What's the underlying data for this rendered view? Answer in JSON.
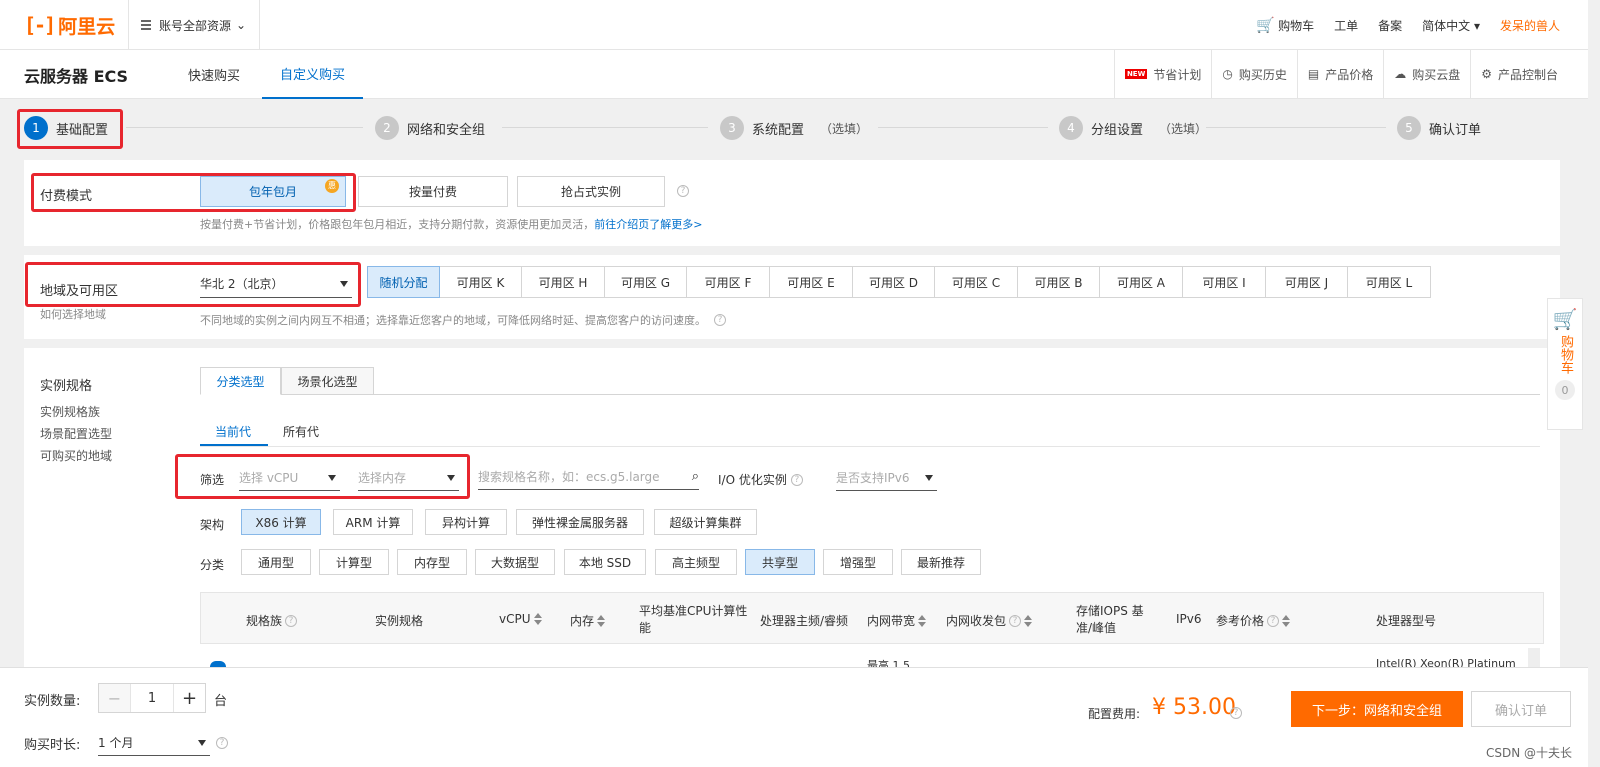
{
  "topbar": {
    "logo_text": "阿里云",
    "account_scope": "账号全部资源",
    "nav": [
      "购物车",
      "工单",
      "备案",
      "简体中文"
    ],
    "user": "发呆的兽人"
  },
  "product": {
    "name": "云服务器 ECS",
    "tabs": [
      "快速购买",
      "自定义购买"
    ],
    "tools": [
      "节省计划",
      "购买历史",
      "产品价格",
      "购买云盘",
      "产品控制台"
    ],
    "new_badge": "NEW"
  },
  "steps": [
    {
      "num": "1",
      "label": "基础配置",
      "opt": ""
    },
    {
      "num": "2",
      "label": "网络和安全组",
      "opt": ""
    },
    {
      "num": "3",
      "label": "系统配置",
      "opt": "（选填）"
    },
    {
      "num": "4",
      "label": "分组设置",
      "opt": "（选填）"
    },
    {
      "num": "5",
      "label": "确认订单",
      "opt": ""
    }
  ],
  "billing": {
    "label": "付费模式",
    "options": [
      "包年包月",
      "按量付费",
      "抢占式实例"
    ],
    "hint": "按量付费+节省计划，价格跟包年包月相近，支持分期付款，资源使用更加灵活，",
    "hint_link": "前往介绍页了解更多>"
  },
  "region": {
    "label": "地域及可用区",
    "sub_link": "如何选择地域",
    "selected": "华北 2（北京）",
    "zones": [
      "随机分配",
      "可用区 K",
      "可用区 H",
      "可用区 G",
      "可用区 F",
      "可用区 E",
      "可用区 D",
      "可用区 C",
      "可用区 B",
      "可用区 A",
      "可用区 I",
      "可用区 J",
      "可用区 L"
    ],
    "hint": "不同地域的实例之间内网互不相通；选择靠近您客户的地域，可降低网络时延、提高您客户的访问速度。"
  },
  "instance": {
    "label": "实例规格",
    "side_links": [
      "实例规格族",
      "场景配置选型",
      "可购买的地域"
    ],
    "tabs": [
      "分类选型",
      "场景化选型"
    ],
    "gens": [
      "当前代",
      "所有代"
    ],
    "filter_label": "筛选",
    "vcpu_placeholder": "选择 vCPU",
    "mem_placeholder": "选择内存",
    "search_placeholder": "搜索规格名称，如：ecs.g5.large",
    "io_label": "I/O 优化实例",
    "ipv6_placeholder": "是否支持IPv6",
    "arch_label": "架构",
    "arch": [
      "X86 计算",
      "ARM 计算",
      "异构计算",
      "弹性裸金属服务器",
      "超级计算集群"
    ],
    "cat_label": "分类",
    "categories": [
      "通用型",
      "计算型",
      "内存型",
      "大数据型",
      "本地 SSD",
      "高主频型",
      "共享型",
      "增强型",
      "最新推荐"
    ],
    "table_headers": [
      "规格族",
      "实例规格",
      "vCPU",
      "内存",
      "平均基准CPU计算性能",
      "处理器主频/睿频",
      "内网带宽",
      "内网收发包",
      "存储IOPS 基准/峰值",
      "IPv6",
      "参考价格",
      "处理器型号"
    ],
    "row_partial": [
      "最高 1.5",
      "Intel(R) Xeon(R) Platinum"
    ]
  },
  "footer": {
    "qty_label": "实例数量:",
    "qty": "1",
    "qty_unit": "台",
    "duration_label": "购买时长:",
    "duration": "1 个月",
    "cost_label": "配置费用:",
    "cost": "¥ 53.00",
    "next": "下一步：网络和安全组",
    "confirm": "确认订单",
    "watermark": "CSDN @十夫长"
  },
  "float_cart": {
    "label": "购物车",
    "count": "0"
  },
  "colors": {
    "brand": "#ff6a00",
    "link": "#0070cc",
    "highlight": "#e7262e"
  }
}
